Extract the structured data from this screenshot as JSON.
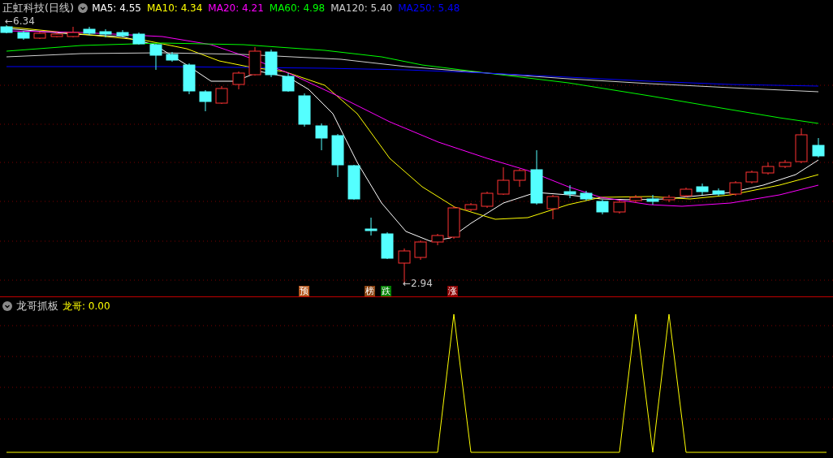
{
  "main_panel": {
    "title": "正虹科技(日线)",
    "indicators": [
      {
        "label": "MA5: 4.55",
        "color": "#ffffff"
      },
      {
        "label": "MA10: 4.34",
        "color": "#ffff00"
      },
      {
        "label": "MA20: 4.21",
        "color": "#ff00ff"
      },
      {
        "label": "MA60: 4.98",
        "color": "#00ff00"
      },
      {
        "label": "MA120: 5.40",
        "color": "#d0d0d0"
      },
      {
        "label": "MA250: 5.48",
        "color": "#0000ff"
      }
    ],
    "price_marks": [
      {
        "text": "←6.34"
      },
      {
        "text": "←2.94"
      }
    ],
    "signals": [
      {
        "text": "预",
        "color": "#b5561c"
      },
      {
        "text": "榜",
        "color": "#8b4513"
      },
      {
        "text": "跌",
        "color": "#007f00"
      },
      {
        "text": "涨",
        "color": "#8b0000"
      }
    ]
  },
  "sub_panel": {
    "title": "龙哥抓板",
    "indicators": [
      {
        "label": "龙哥: 0.00",
        "color": "#ffff00"
      }
    ]
  }
}
